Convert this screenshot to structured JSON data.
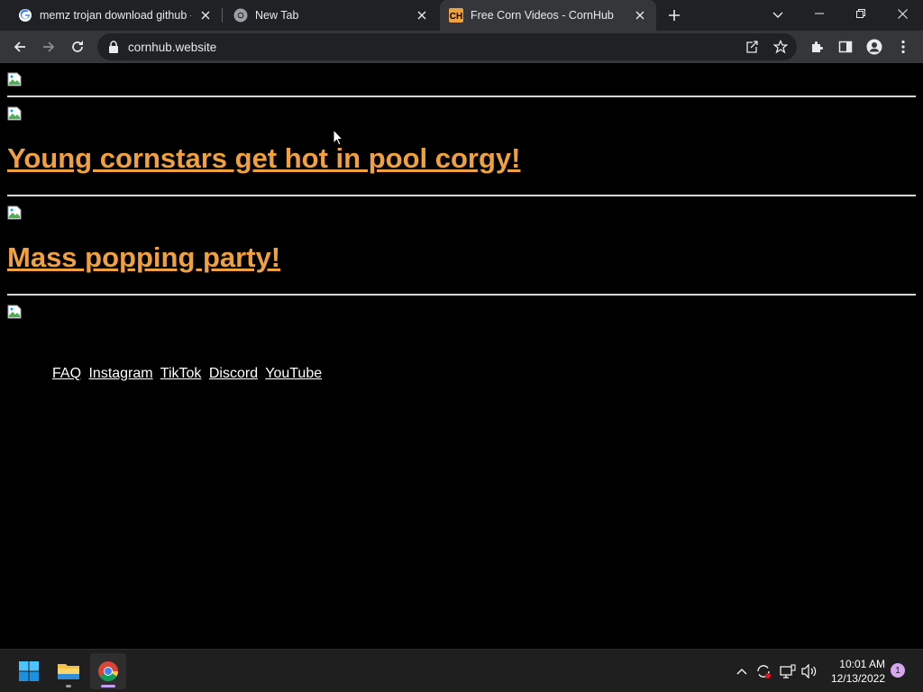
{
  "browser": {
    "tabs": [
      {
        "title": "memz trojan download github - G",
        "favicon": "google-icon",
        "active": false
      },
      {
        "title": "New Tab",
        "favicon": "chrome-icon",
        "active": false
      },
      {
        "title": "Free Corn Videos - CornHub",
        "favicon": "cornhub-icon",
        "active": true
      }
    ],
    "url": "cornhub.website",
    "accent": "#f0a03c"
  },
  "page": {
    "headlines": [
      "Young cornstars get hot in pool corgy!",
      "Mass popping party!"
    ],
    "footer_links": [
      "FAQ",
      "Instagram",
      "TikTok",
      "Discord",
      "YouTube"
    ]
  },
  "taskbar": {
    "apps": [
      "windows-start-icon",
      "file-explorer-icon",
      "chrome-icon"
    ],
    "time": "10:01 AM",
    "date": "12/13/2022",
    "notification_count": "1"
  }
}
